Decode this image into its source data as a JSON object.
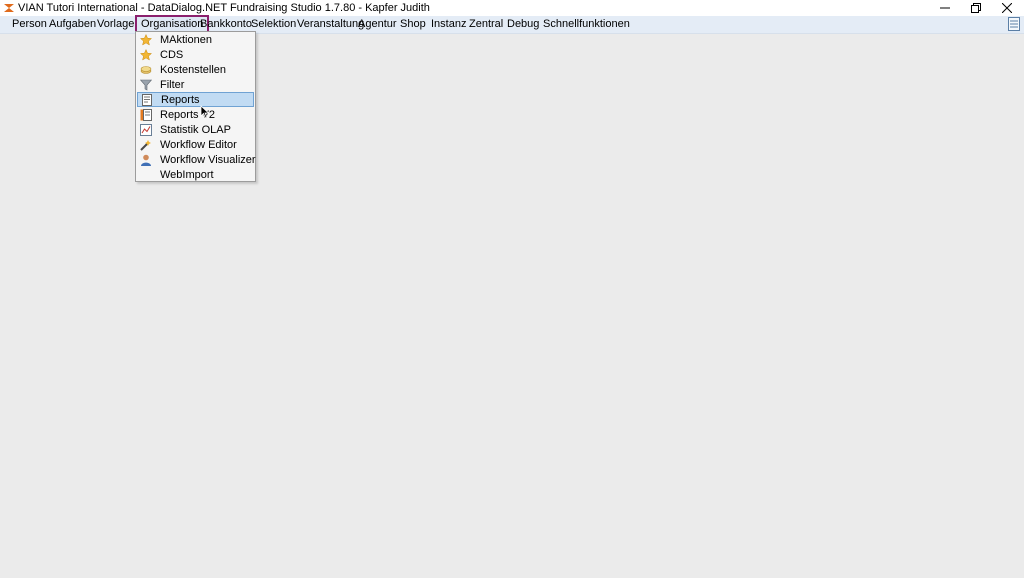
{
  "window": {
    "title": "VIAN Tutori International - DataDialog.NET Fundraising Studio 1.7.80 - Kapfer Judith",
    "controls": [
      "minimize-icon",
      "restore-icon",
      "close-icon"
    ]
  },
  "menubar": {
    "items": [
      {
        "label": "Person"
      },
      {
        "label": "Aufgaben"
      },
      {
        "label": "Vorlagen"
      },
      {
        "label": "Organisation",
        "active": true
      },
      {
        "label": "Bankkonto"
      },
      {
        "label": "Selektion"
      },
      {
        "label": "Veranstaltung"
      },
      {
        "label": "Agentur"
      },
      {
        "label": "Shop"
      },
      {
        "label": "Instanz"
      },
      {
        "label": "Zentral"
      },
      {
        "label": "Debug"
      },
      {
        "label": "Schnellfunktionen"
      }
    ]
  },
  "dropdown": {
    "items": [
      {
        "label": "MAktionen",
        "icon": "star-icon"
      },
      {
        "label": "CDS",
        "icon": "star-icon"
      },
      {
        "label": "Kostenstellen",
        "icon": "coins-icon"
      },
      {
        "label": "Filter",
        "icon": "funnel-icon"
      },
      {
        "label": "Reports",
        "icon": "report-icon",
        "hover": true
      },
      {
        "label": "Reports V2",
        "icon": "report-v2-icon"
      },
      {
        "label": "Statistik OLAP",
        "icon": "chart-icon"
      },
      {
        "label": "Workflow Editor",
        "icon": "wand-icon"
      },
      {
        "label": "Workflow Visualizer",
        "icon": "user-icon"
      },
      {
        "label": "WebImport",
        "icon": ""
      }
    ]
  },
  "colors": {
    "menubar": "#e4ecf6",
    "active_border": "#8b1f6d",
    "hover_bg": "#c1dbf3",
    "workspace": "#ebebeb"
  }
}
